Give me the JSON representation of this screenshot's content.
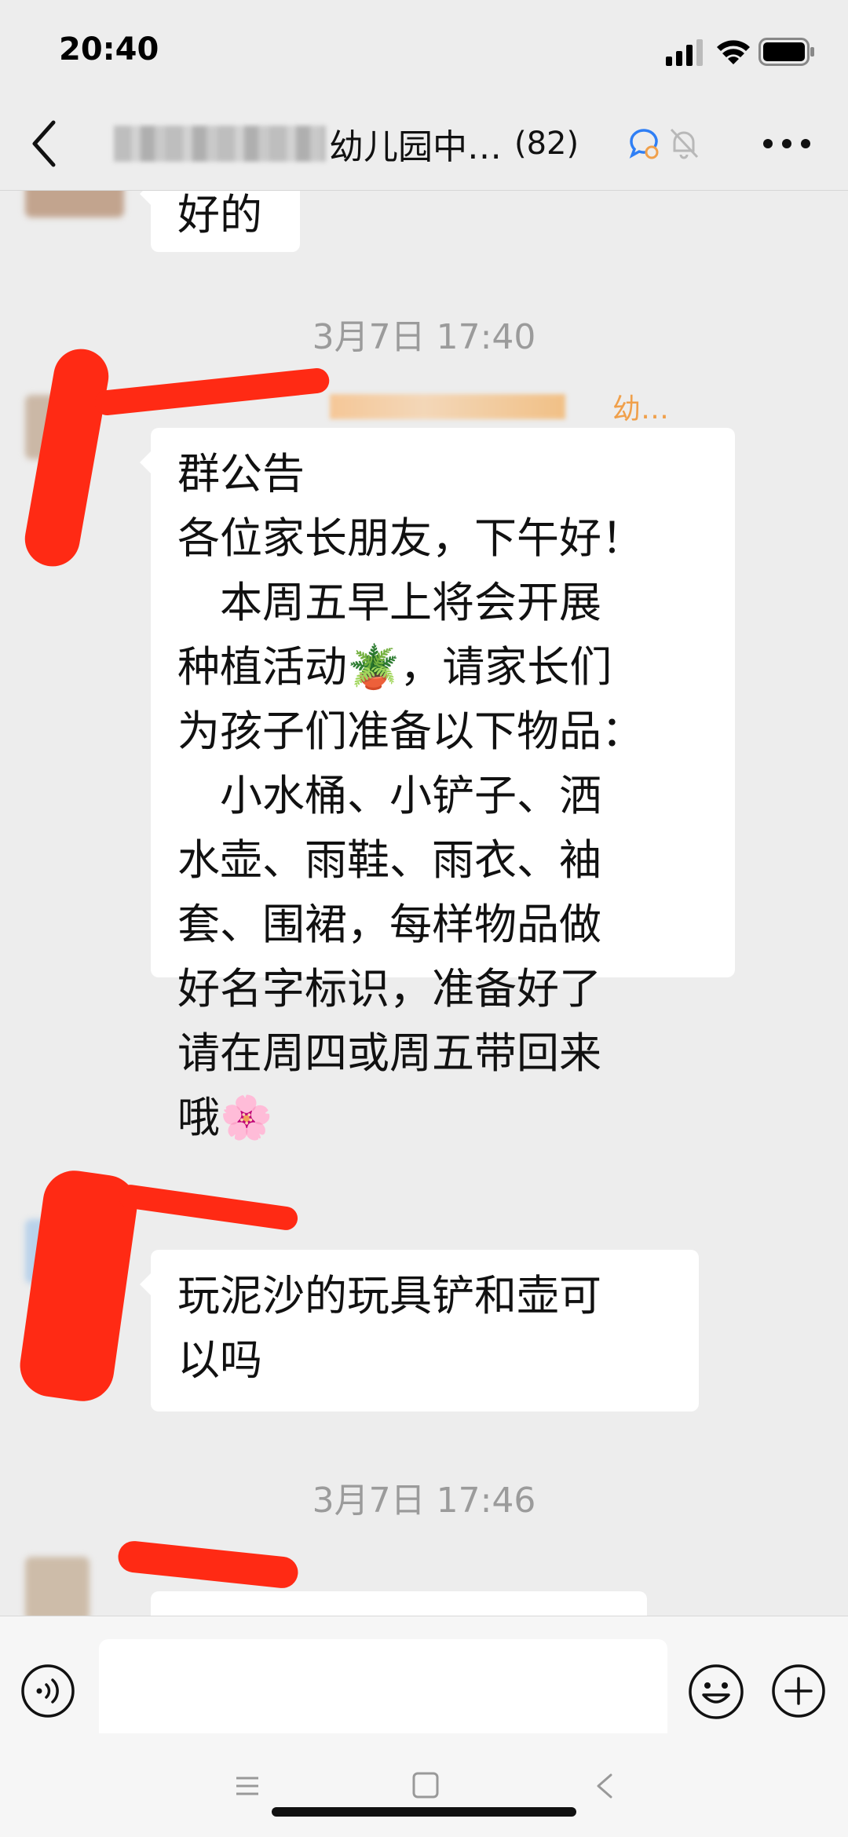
{
  "status": {
    "time": "20:40"
  },
  "header": {
    "title": "幼儿园中…",
    "member_count": "(82)"
  },
  "messages": [
    {
      "text": "好的"
    },
    {
      "timestamp": "3月7日 17:40"
    },
    {
      "sender_suffix": "幼…",
      "lines": [
        "群公告",
        "各位家长朋友，下午好！",
        "　本周五早上将会开展",
        "种植活动🪴，请家长们",
        "为孩子们准备以下物品：",
        "　小水桶、小铲子、洒",
        "水壶、雨鞋、雨衣、袖",
        "套、围裙，每样物品做",
        "好名字标识，准备好了",
        "请在周四或周五带回来",
        "哦🌸"
      ]
    },
    {
      "lines": [
        "玩泥沙的玩具铲和壶可",
        "以吗"
      ]
    },
    {
      "timestamp": "3月7日 17:46"
    }
  ],
  "icons": {
    "back": "chevron-left-icon",
    "chat": "chat-bubble-icon",
    "mute": "bell-off-icon",
    "more": "more-icon",
    "voice": "voice-icon",
    "emoji": "emoji-icon",
    "plus": "plus-icon"
  },
  "colors": {
    "background": "#ededed",
    "bubble": "#ffffff",
    "sender_name": "#f0a04b",
    "accent": "#2f7ff5",
    "redaction": "#ff2a14"
  }
}
